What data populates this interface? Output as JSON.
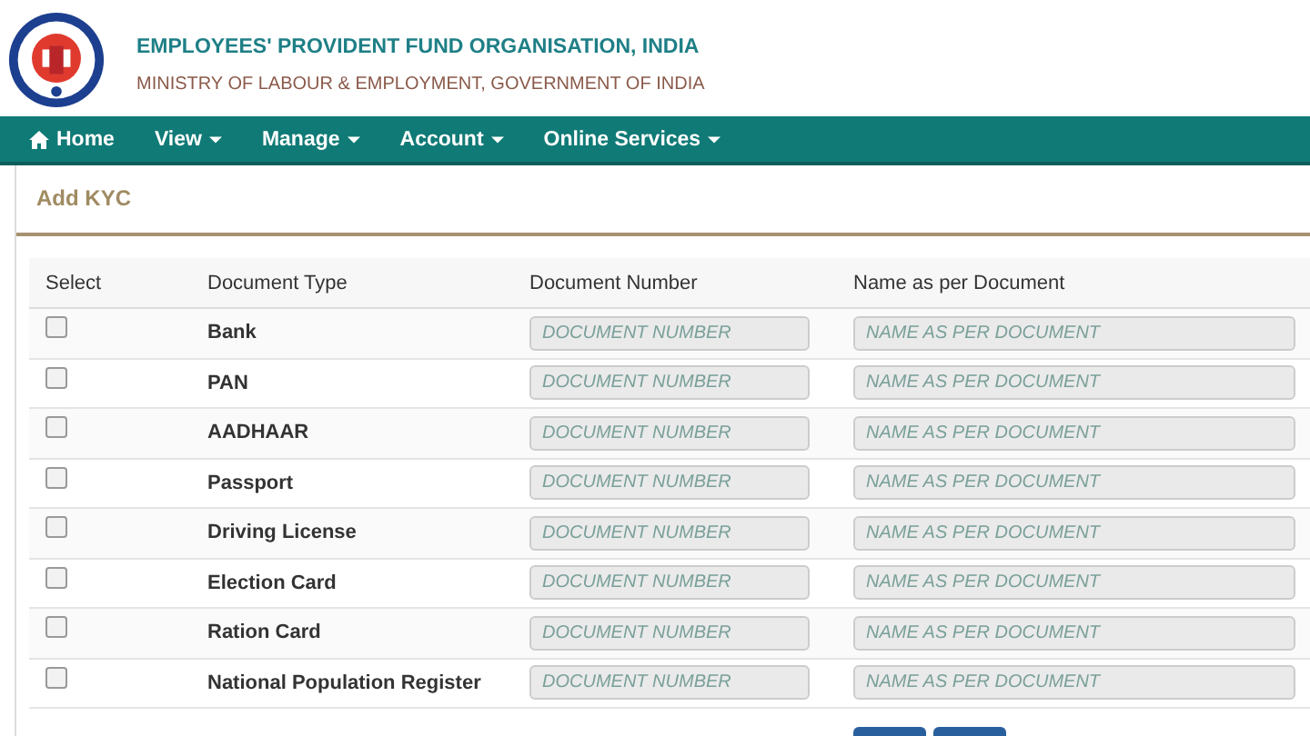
{
  "header": {
    "title": "EMPLOYEES' PROVIDENT FUND ORGANISATION, INDIA",
    "subtitle": "MINISTRY OF LABOUR & EMPLOYMENT, GOVERNMENT OF INDIA"
  },
  "nav": [
    {
      "label": "Home",
      "kind": "home",
      "dropdown": false
    },
    {
      "label": "View",
      "dropdown": true
    },
    {
      "label": "Manage",
      "dropdown": true
    },
    {
      "label": "Account",
      "dropdown": true
    },
    {
      "label": "Online Services",
      "dropdown": true
    }
  ],
  "panel_title": "Add KYC",
  "table": {
    "columns": [
      "Select",
      "Document Type",
      "Document Number",
      "Name as per Document"
    ],
    "rows": [
      {
        "checked": false,
        "document_type": "Bank",
        "number_placeholder": "DOCUMENT NUMBER",
        "name_placeholder": "NAME AS PER DOCUMENT"
      },
      {
        "checked": false,
        "document_type": "PAN",
        "number_placeholder": "DOCUMENT NUMBER",
        "name_placeholder": "NAME AS PER DOCUMENT"
      },
      {
        "checked": false,
        "document_type": "AADHAAR",
        "number_placeholder": "DOCUMENT NUMBER",
        "name_placeholder": "NAME AS PER DOCUMENT"
      },
      {
        "checked": false,
        "document_type": "Passport",
        "number_placeholder": "DOCUMENT NUMBER",
        "name_placeholder": "NAME AS PER DOCUMENT"
      },
      {
        "checked": false,
        "document_type": "Driving License",
        "number_placeholder": "DOCUMENT NUMBER",
        "name_placeholder": "NAME AS PER DOCUMENT"
      },
      {
        "checked": false,
        "document_type": "Election Card",
        "number_placeholder": "DOCUMENT NUMBER",
        "name_placeholder": "NAME AS PER DOCUMENT"
      },
      {
        "checked": false,
        "document_type": "Ration Card",
        "number_placeholder": "DOCUMENT NUMBER",
        "name_placeholder": "NAME AS PER DOCUMENT"
      },
      {
        "checked": false,
        "document_type": "National Population Register",
        "number_placeholder": "DOCUMENT NUMBER",
        "name_placeholder": "NAME AS PER DOCUMENT"
      }
    ]
  }
}
